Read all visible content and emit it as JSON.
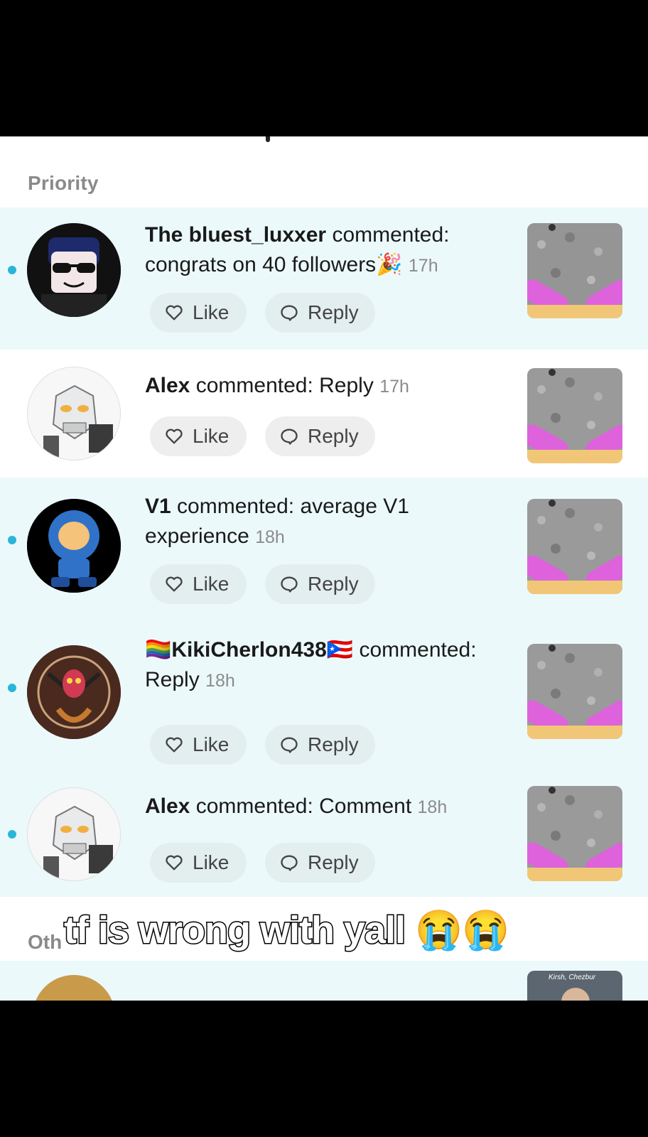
{
  "sections": {
    "priority_label": "Priority",
    "other_label_visible": "Oth"
  },
  "colors": {
    "unread_bg": "#ecf9fb",
    "unread_dot": "#28b6d8",
    "button_bg": "#e3eeef"
  },
  "buttons": {
    "like_label": "Like",
    "reply_label": "Reply"
  },
  "notifications": [
    {
      "user": "The bluest_luxxer",
      "action": "commented:",
      "comment": "congrats on 40 followers🎉",
      "time": "17h",
      "unread": true,
      "avatar_icon": "sunglasses-avatar"
    },
    {
      "user": "Alex",
      "action": "commented:",
      "comment": "Reply",
      "time": "17h",
      "unread": false,
      "avatar_icon": "robot-avatar"
    },
    {
      "user": "V1",
      "action": "commented:",
      "comment": "average V1 experience",
      "time": "18h",
      "unread": true,
      "avatar_icon": "blue-robot-avatar"
    },
    {
      "user": "🏳️‍🌈KikiCherlon438🇵🇷",
      "action": "commented:",
      "comment": "Reply",
      "time": "18h",
      "unread": true,
      "avatar_icon": "demon-art-avatar"
    },
    {
      "user": "Alex",
      "action": "commented:",
      "comment": "Comment",
      "time": "18h",
      "unread": true,
      "avatar_icon": "robot-avatar"
    }
  ],
  "thumbnail_caption": "Kirsh, Chezbur",
  "overlay_caption": "tf is wrong with yall 😭😭"
}
